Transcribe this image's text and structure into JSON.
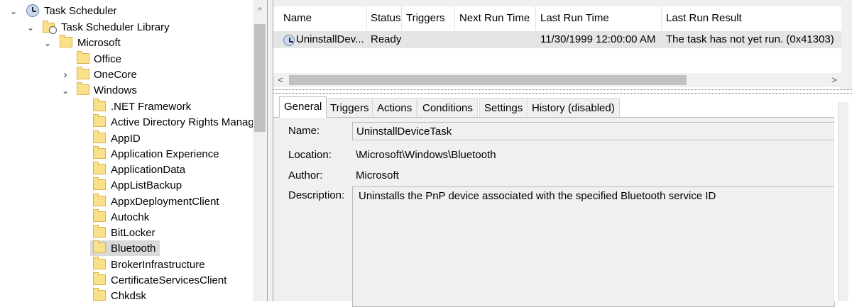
{
  "tree": {
    "items": [
      {
        "label": "Task Scheduler",
        "chevron": "expanded",
        "icon": "clock-icon"
      },
      {
        "label": "Task Scheduler Library",
        "chevron": "expanded",
        "icon": "library-folder-icon"
      },
      {
        "label": "Microsoft",
        "chevron": "expanded",
        "icon": "folder-icon"
      },
      {
        "label": "Office",
        "chevron": "none",
        "icon": "folder-icon"
      },
      {
        "label": "OneCore",
        "chevron": "collapsed",
        "icon": "folder-icon"
      },
      {
        "label": "Windows",
        "chevron": "expanded",
        "icon": "folder-icon"
      },
      {
        "label": ".NET Framework",
        "icon": "folder-icon"
      },
      {
        "label": "Active Directory Rights Manage",
        "icon": "folder-icon"
      },
      {
        "label": "AppID",
        "icon": "folder-icon"
      },
      {
        "label": "Application Experience",
        "icon": "folder-icon"
      },
      {
        "label": "ApplicationData",
        "icon": "folder-icon"
      },
      {
        "label": "AppListBackup",
        "icon": "folder-icon"
      },
      {
        "label": "AppxDeploymentClient",
        "icon": "folder-icon"
      },
      {
        "label": "Autochk",
        "icon": "folder-icon"
      },
      {
        "label": "BitLocker",
        "icon": "folder-icon"
      },
      {
        "label": "Bluetooth",
        "icon": "folder-icon",
        "selected": true
      },
      {
        "label": "BrokerInfrastructure",
        "icon": "folder-icon"
      },
      {
        "label": "CertificateServicesClient",
        "icon": "folder-icon"
      },
      {
        "label": "Chkdsk",
        "icon": "folder-icon"
      }
    ],
    "glyphs": {
      "expanded": "⌄",
      "collapsed": "›",
      "up": "^"
    }
  },
  "task_list": {
    "columns": [
      "Name",
      "Status",
      "Triggers",
      "Next Run Time",
      "Last Run Time",
      "Last Run Result"
    ],
    "rows": [
      {
        "name": "UninstallDev...",
        "status": "Ready",
        "triggers": "",
        "next_run_time": "",
        "last_run_time": "11/30/1999 12:00:00 AM",
        "last_run_result": "The task has not yet run. (0x41303)"
      }
    ],
    "scroll_left": "<",
    "scroll_right": ">"
  },
  "details": {
    "tabs": [
      "General",
      "Triggers",
      "Actions",
      "Conditions",
      "Settings",
      "History (disabled)"
    ],
    "active_tab": "General",
    "fields": {
      "name_label": "Name:",
      "name_value": "UninstallDeviceTask",
      "location_label": "Location:",
      "location_value": "\\Microsoft\\Windows\\Bluetooth",
      "author_label": "Author:",
      "author_value": "Microsoft",
      "description_label": "Description:",
      "description_value": "Uninstalls the PnP device associated with the specified Bluetooth service ID"
    }
  },
  "colors": {
    "selection": "#d9d9d9",
    "row_highlight": "#e5e5e5",
    "panel_bg": "#f0f0f0",
    "folder_fill": "#fbe08a"
  }
}
